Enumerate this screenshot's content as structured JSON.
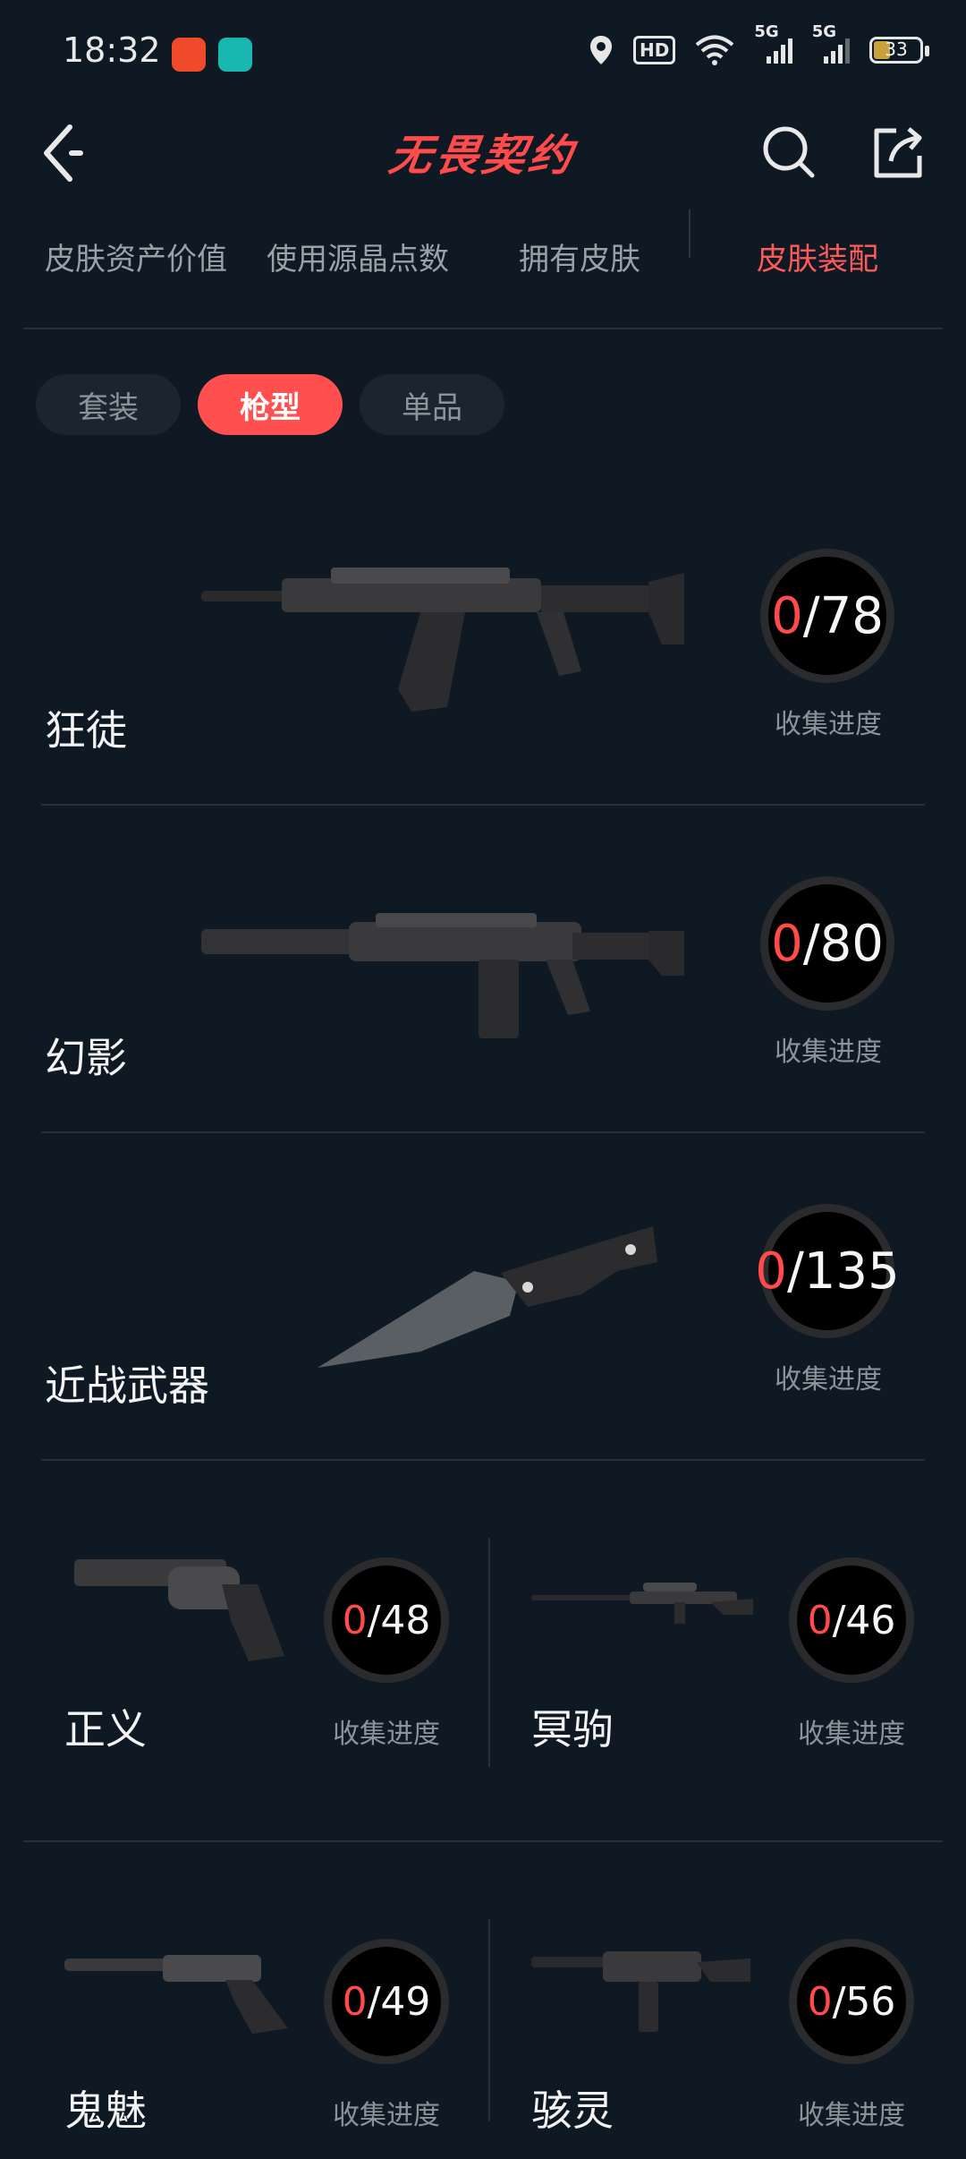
{
  "status": {
    "time": "18:32",
    "hd": "HD",
    "net1": "5G",
    "net2": "5G",
    "battery": "33"
  },
  "header": {
    "title": "无畏契约"
  },
  "tabs": [
    {
      "label": "皮肤资产价值"
    },
    {
      "label": "使用源晶点数"
    },
    {
      "label": "拥有皮肤"
    },
    {
      "label": "皮肤装配"
    }
  ],
  "filters": [
    {
      "label": "套装"
    },
    {
      "label": "枪型"
    },
    {
      "label": "单品"
    }
  ],
  "progress_label": "收集进度",
  "weapons": [
    {
      "name": "狂徒",
      "collected": "0",
      "total": "/78",
      "icon": "vandal-rifle-icon"
    },
    {
      "name": "幻影",
      "collected": "0",
      "total": "/80",
      "icon": "phantom-rifle-icon"
    },
    {
      "name": "近战武器",
      "collected": "0",
      "total": "/135",
      "icon": "tactical-knife-icon"
    },
    {
      "name": "正义",
      "collected": "0",
      "total": "/48",
      "icon": "sheriff-revolver-icon"
    },
    {
      "name": "冥驹",
      "collected": "0",
      "total": "/46",
      "icon": "operator-sniper-icon"
    },
    {
      "name": "鬼魅",
      "collected": "0",
      "total": "/49",
      "icon": "ghost-pistol-icon"
    },
    {
      "name": "骇灵",
      "collected": "0",
      "total": "/56",
      "icon": "spectre-smg-icon"
    }
  ],
  "colors": {
    "accent": "#ff4b4b",
    "background": "#0f1923",
    "text_muted": "#8d939b"
  }
}
